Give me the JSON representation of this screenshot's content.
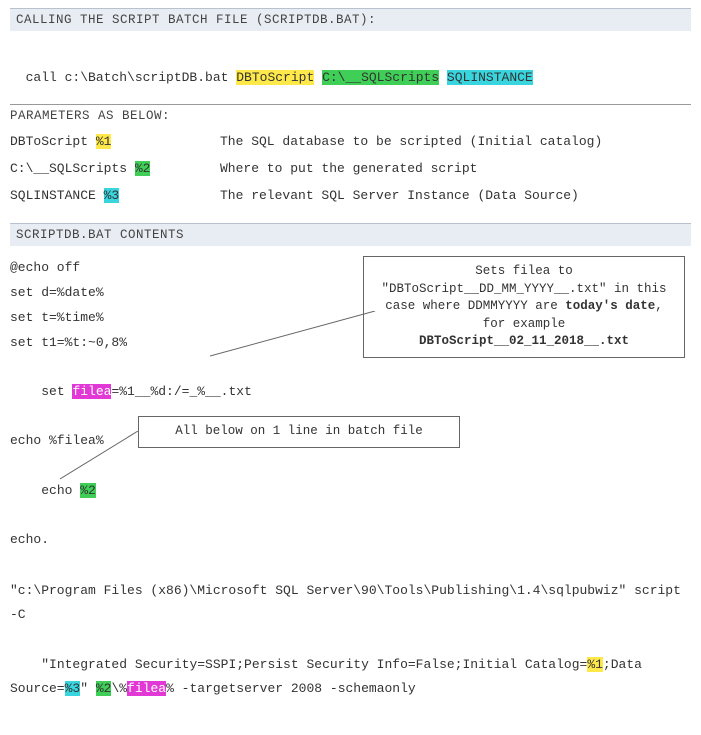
{
  "section1": {
    "title": "CALLING THE SCRIPT BATCH FILE (SCRIPTDB.BAT):",
    "call_prefix": "call c:\\Batch\\scriptDB.bat ",
    "arg1": "DBToScript",
    "arg2": "C:\\__SQLScripts",
    "arg3": "SQLINSTANCE"
  },
  "params": {
    "title": "PARAMETERS AS BELOW:",
    "rows": [
      {
        "name": "DBToScript ",
        "ph": "%1",
        "ph_class": "hl-yellow",
        "desc": "The SQL database to be scripted (Initial catalog)"
      },
      {
        "name": "C:\\__SQLScripts ",
        "ph": "%2",
        "ph_class": "hl-green",
        "desc": "Where to put the generated script"
      },
      {
        "name": "SQLINSTANCE ",
        "ph": "%3",
        "ph_class": "hl-cyan",
        "desc": "The relevant SQL Server Instance (Data Source)"
      }
    ]
  },
  "section2": {
    "title": "SCRIPTDB.BAT CONTENTS",
    "lines_a": [
      "@echo off",
      "set d=%date%",
      "set t=%time%",
      "set t1=%t:~0,8%"
    ],
    "set_filea_pre": "set ",
    "set_filea_var": "filea",
    "set_filea_post": "=%1__%d:/=_%__.txt",
    "echo_filea": "echo %filea%",
    "echo2_pre": "echo ",
    "echo2_arg": "%2",
    "echo_dot": "echo.",
    "long1_a": "\"c:\\Program Files (x86)\\Microsoft SQL Server\\90\\Tools\\Publishing\\1.4\\sqlpubwiz\" script -C",
    "long2_a": "\"Integrated Security=SSPI;Persist Security Info=False;Initial Catalog=",
    "long2_p1": "%1",
    "long2_b": ";Data Source=",
    "long2_p3": "%3",
    "long2_c": "\" ",
    "long2_p2": "%2",
    "long2_d": "\\%",
    "long2_var": "filea",
    "long2_e": "% -targetserver 2008 -schemaonly"
  },
  "notes": {
    "n1_l1": "Sets filea to",
    "n1_l2a": "\"DBToScript__DD_MM_YYYY__.txt\" in this case where DDMMYYYY are ",
    "n1_l2b": "today's date",
    "n1_l2c": ", for example",
    "n1_l3": "DBToScript__02_11_2018__.txt",
    "n2": "All below on 1 line in batch file"
  }
}
